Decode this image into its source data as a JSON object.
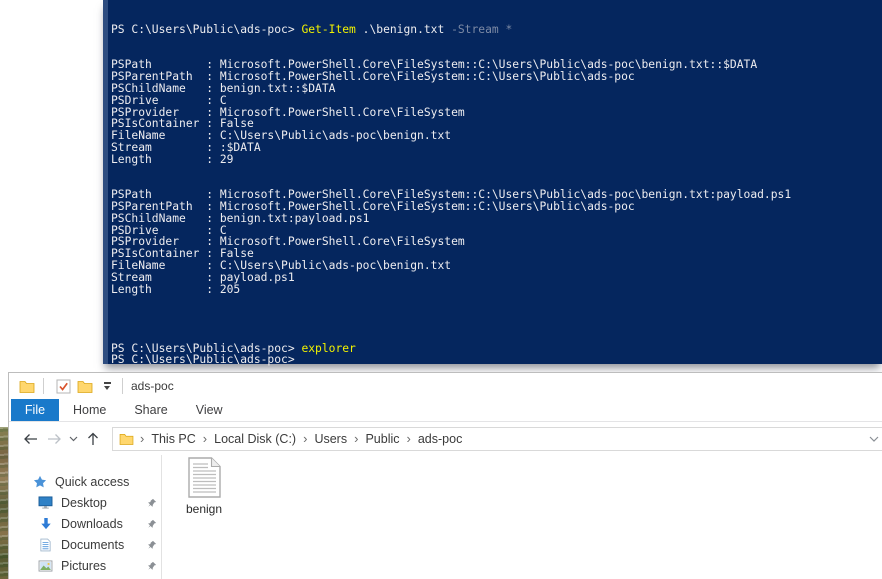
{
  "colors": {
    "console_bg": "#05265e",
    "console_border": "#2e4d80",
    "fg": "#eeedf0",
    "cmd": "#f2f200",
    "param": "#7d8aa5",
    "accent_blue": "#1979ca",
    "folder_yellow": "#ffd76e"
  },
  "console": {
    "colors": {
      "fg": "#eeedf0",
      "cmd": "#f2f200",
      "param": "#7d8aa5"
    },
    "lines": [
      [
        [
          "PS C:\\Users\\Public\\ads-poc> ",
          "fg"
        ],
        [
          "Get-Item",
          "cmd"
        ],
        [
          " .\\benign.txt ",
          "fg"
        ],
        [
          "-Stream *",
          "param"
        ]
      ],
      [],
      [],
      [
        [
          "PSPath        : Microsoft.PowerShell.Core\\FileSystem::C:\\Users\\Public\\ads-poc\\benign.txt::$DATA",
          "fg"
        ]
      ],
      [
        [
          "PSParentPath  : Microsoft.PowerShell.Core\\FileSystem::C:\\Users\\Public\\ads-poc",
          "fg"
        ]
      ],
      [
        [
          "PSChildName   : benign.txt::$DATA",
          "fg"
        ]
      ],
      [
        [
          "PSDrive       : C",
          "fg"
        ]
      ],
      [
        [
          "PSProvider    : Microsoft.PowerShell.Core\\FileSystem",
          "fg"
        ]
      ],
      [
        [
          "PSIsContainer : False",
          "fg"
        ]
      ],
      [
        [
          "FileName      : C:\\Users\\Public\\ads-poc\\benign.txt",
          "fg"
        ]
      ],
      [
        [
          "Stream        : :$DATA",
          "fg"
        ]
      ],
      [
        [
          "Length        : 29",
          "fg"
        ]
      ],
      [],
      [],
      [
        [
          "PSPath        : Microsoft.PowerShell.Core\\FileSystem::C:\\Users\\Public\\ads-poc\\benign.txt:payload.ps1",
          "fg"
        ]
      ],
      [
        [
          "PSParentPath  : Microsoft.PowerShell.Core\\FileSystem::C:\\Users\\Public\\ads-poc",
          "fg"
        ]
      ],
      [
        [
          "PSChildName   : benign.txt:payload.ps1",
          "fg"
        ]
      ],
      [
        [
          "PSDrive       : C",
          "fg"
        ]
      ],
      [
        [
          "PSProvider    : Microsoft.PowerShell.Core\\FileSystem",
          "fg"
        ]
      ],
      [
        [
          "PSIsContainer : False",
          "fg"
        ]
      ],
      [
        [
          "FileName      : C:\\Users\\Public\\ads-poc\\benign.txt",
          "fg"
        ]
      ],
      [
        [
          "Stream        : payload.ps1",
          "fg"
        ]
      ],
      [
        [
          "Length        : 205",
          "fg"
        ]
      ],
      [],
      [],
      [],
      [],
      [
        [
          "PS C:\\Users\\Public\\ads-poc> ",
          "fg"
        ],
        [
          "explorer",
          "cmd"
        ]
      ],
      [
        [
          "PS C:\\Users\\Public\\ads-poc>",
          "fg"
        ]
      ]
    ]
  },
  "explorer": {
    "window_title": "ads-poc",
    "qat_icons": [
      "window-folder-icon",
      "checkmark-icon",
      "folder-icon",
      "customize-qat-caret"
    ],
    "tabs": [
      {
        "label": "File",
        "active": true
      },
      {
        "label": "Home",
        "active": false
      },
      {
        "label": "Share",
        "active": false
      },
      {
        "label": "View",
        "active": false
      }
    ],
    "nav_icons": [
      "back-arrow-icon",
      "forward-arrow-icon",
      "history-chevron-icon",
      "up-arrow-icon"
    ],
    "breadcrumb": {
      "separator": "›",
      "items": [
        "This PC",
        "Local Disk (C:)",
        "Users",
        "Public",
        "ads-poc"
      ]
    },
    "sidebar": {
      "section_label": "Quick access",
      "section_icon": "star-icon",
      "items": [
        {
          "label": "Desktop",
          "icon": "desktop-icon",
          "pinned": true
        },
        {
          "label": "Downloads",
          "icon": "downloads-icon",
          "pinned": true
        },
        {
          "label": "Documents",
          "icon": "documents-icon",
          "pinned": true
        },
        {
          "label": "Pictures",
          "icon": "pictures-icon",
          "pinned": true
        }
      ]
    },
    "files": [
      {
        "name": "benign",
        "icon": "text-document-icon"
      }
    ]
  }
}
